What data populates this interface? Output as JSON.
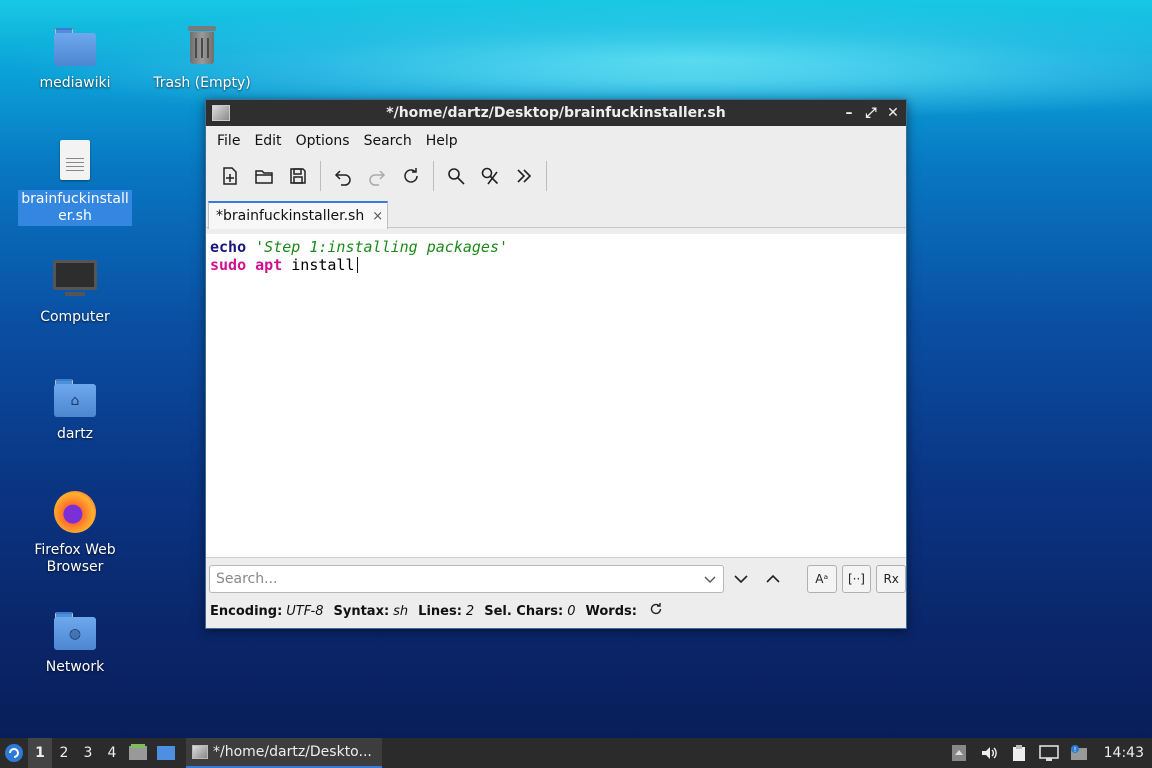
{
  "desktop": {
    "icons": [
      {
        "label": "mediawiki",
        "icon": "folder-icon"
      },
      {
        "label": "Trash (Empty)",
        "icon": "trash-icon"
      },
      {
        "label": "brainfuckinstaller.sh",
        "icon": "text-file-icon"
      },
      {
        "label": "Computer",
        "icon": "computer-icon"
      },
      {
        "label": "dartz",
        "icon": "home-folder-icon"
      },
      {
        "label": "Firefox Web Browser",
        "icon": "firefox-icon"
      },
      {
        "label": "Network",
        "icon": "network-folder-icon"
      }
    ],
    "selected_icon_color": "#3c8ce6"
  },
  "window": {
    "title": "*/home/dartz/Desktop/brainfuckinstaller.sh",
    "controls": [
      "minimize-icon",
      "maximize-icon",
      "close-icon"
    ],
    "menu": [
      "File",
      "Edit",
      "Options",
      "Search",
      "Help"
    ],
    "toolbar": [
      "new-file-icon",
      "open-icon",
      "save-icon",
      "undo-icon",
      "redo-icon",
      "reload-icon",
      "find-icon",
      "replace-icon",
      "more-icon"
    ],
    "tab": {
      "label": "*brainfuckinstaller.sh",
      "close": "×"
    },
    "editor": {
      "line1": {
        "keyword": "echo",
        "string": "'Step 1:installing packages'"
      },
      "line2": {
        "cmd": "sudo",
        "arg1": "apt",
        "rest": "install"
      }
    },
    "search": {
      "placeholder": "Search...",
      "toggles": [
        "Aᵃ",
        "[··]",
        "Rx"
      ]
    },
    "status": {
      "encoding_label": "Encoding:",
      "encoding": "UTF-8",
      "syntax_label": "Syntax:",
      "syntax": "sh",
      "lines_label": "Lines:",
      "lines": "2",
      "sel_label": "Sel. Chars:",
      "sel": "0",
      "words_label": "Words:"
    },
    "accent": "#3a7bd5"
  },
  "taskbar": {
    "workspaces": [
      "1",
      "2",
      "3",
      "4"
    ],
    "active_workspace": "1",
    "task_label": "*/home/dartz/Deskto...",
    "clock": "14:43"
  }
}
